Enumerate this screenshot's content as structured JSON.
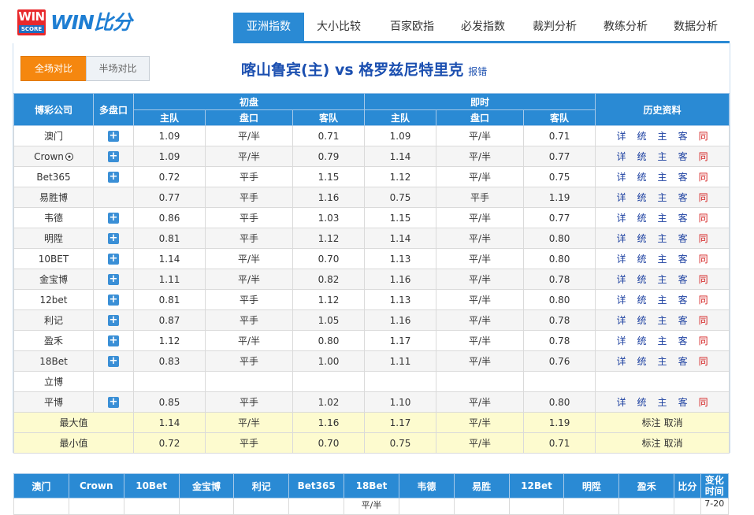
{
  "logo": {
    "box_line1": "WIN",
    "box_line2": "SCORE",
    "text": "WIN比分"
  },
  "nav": [
    {
      "label": "亚洲指数",
      "active": true
    },
    {
      "label": "大小比较",
      "active": false
    },
    {
      "label": "百家欧指",
      "active": false
    },
    {
      "label": "必发指数",
      "active": false
    },
    {
      "label": "裁判分析",
      "active": false
    },
    {
      "label": "教练分析",
      "active": false
    },
    {
      "label": "数据分析",
      "active": false
    }
  ],
  "tabs": {
    "full": "全场对比",
    "half": "半场对比"
  },
  "match": {
    "title": "喀山鲁宾(主) vs 格罗兹尼特里克",
    "report": "报错"
  },
  "table": {
    "h_company": "博彩公司",
    "h_multi": "多盘口",
    "h_initial": "初盘",
    "h_live": "即时",
    "h_history": "历史资料",
    "sub": {
      "home": "主队",
      "line": "盘口",
      "away": "客队"
    }
  },
  "history_links": {
    "detail": "详",
    "stats": "统",
    "home": "主",
    "away": "客",
    "same": "同"
  },
  "rows": [
    {
      "company": "澳门",
      "multi": true,
      "ih": "1.09",
      "il": "平/半",
      "ia": "0.71",
      "lh": "1.09",
      "ll": "平/半",
      "la": "0.71",
      "hist": true
    },
    {
      "company": "Crown",
      "ball": true,
      "multi": true,
      "ih": "1.09",
      "il": "平/半",
      "ia": "0.79",
      "lh": "1.14",
      "ll": "平/半",
      "la": "0.77",
      "hist": true
    },
    {
      "company": "Bet365",
      "multi": true,
      "ih": "0.72",
      "il": "平手",
      "ia": "1.15",
      "lh": "1.12",
      "ll": "平/半",
      "la": "0.75",
      "hist": true
    },
    {
      "company": "易胜博",
      "multi": false,
      "ih": "0.77",
      "il": "平手",
      "ia": "1.16",
      "lh": "0.75",
      "ll": "平手",
      "la": "1.19",
      "hist": true
    },
    {
      "company": "韦德",
      "multi": true,
      "ih": "0.86",
      "il": "平手",
      "ia": "1.03",
      "lh": "1.15",
      "ll": "平/半",
      "la": "0.77",
      "hist": true
    },
    {
      "company": "明陞",
      "multi": true,
      "ih": "0.81",
      "il": "平手",
      "ia": "1.12",
      "lh": "1.14",
      "ll": "平/半",
      "la": "0.80",
      "hist": true
    },
    {
      "company": "10BET",
      "multi": true,
      "ih": "1.14",
      "il": "平/半",
      "ia": "0.70",
      "lh": "1.13",
      "ll": "平/半",
      "la": "0.80",
      "hist": true
    },
    {
      "company": "金宝博",
      "multi": true,
      "ih": "1.11",
      "il": "平/半",
      "ia": "0.82",
      "lh": "1.16",
      "ll": "平/半",
      "la": "0.78",
      "hist": true
    },
    {
      "company": "12bet",
      "multi": true,
      "ih": "0.81",
      "il": "平手",
      "ia": "1.12",
      "lh": "1.13",
      "ll": "平/半",
      "la": "0.80",
      "hist": true
    },
    {
      "company": "利记",
      "multi": true,
      "ih": "0.87",
      "il": "平手",
      "ia": "1.05",
      "lh": "1.16",
      "ll": "平/半",
      "la": "0.78",
      "hist": true
    },
    {
      "company": "盈禾",
      "multi": true,
      "ih": "1.12",
      "il": "平/半",
      "ia": "0.80",
      "lh": "1.17",
      "ll": "平/半",
      "la": "0.78",
      "hist": true
    },
    {
      "company": "18Bet",
      "multi": true,
      "ih": "0.83",
      "il": "平手",
      "ia": "1.00",
      "lh": "1.11",
      "ll": "平/半",
      "la": "0.76",
      "hist": true
    },
    {
      "company": "立博",
      "multi": false,
      "ih": "",
      "il": "",
      "ia": "",
      "lh": "",
      "ll": "",
      "la": "",
      "hist": false
    },
    {
      "company": "平博",
      "multi": true,
      "ih": "0.85",
      "il": "平手",
      "ia": "1.02",
      "lh": "1.10",
      "ll": "平/半",
      "la": "0.80",
      "hist": true
    }
  ],
  "summary": [
    {
      "label": "最大值",
      "ih": "1.14",
      "il": "平/半",
      "ia": "1.16",
      "lh": "1.17",
      "ll": "平/半",
      "la": "1.19",
      "mark": "标注",
      "cancel": "取消"
    },
    {
      "label": "最小值",
      "ih": "0.72",
      "il": "平手",
      "ia": "0.70",
      "lh": "0.75",
      "ll": "平/半",
      "la": "0.71",
      "mark": "标注",
      "cancel": "取消"
    }
  ],
  "bottom": {
    "headers": [
      "澳门",
      "Crown",
      "10Bet",
      "金宝博",
      "利记",
      "Bet365",
      "18Bet",
      "韦德",
      "易胜",
      "12Bet",
      "明陞",
      "盈禾",
      "比分"
    ],
    "change_time": "变化时间",
    "partial": {
      "col18bet": "平/半",
      "time": "7-20"
    }
  }
}
